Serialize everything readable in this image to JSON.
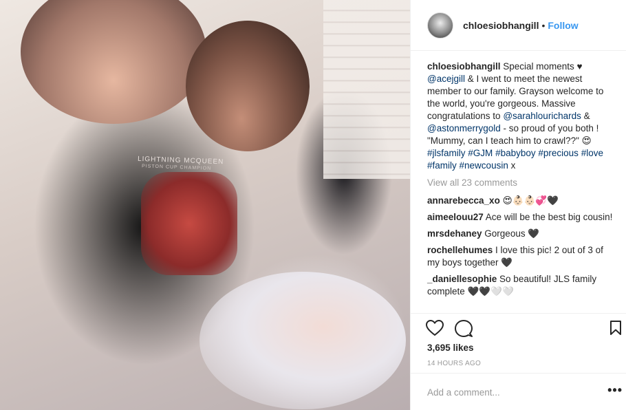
{
  "post": {
    "photo_alt": "Photo of a woman and a toddler with a newborn baby",
    "shirt_text": "LIGHTNING MCQUEEN",
    "shirt_subtext": "PISTON CUP CHAMPION"
  },
  "header": {
    "username": "chloesiobhangill",
    "separator": "•",
    "follow_label": "Follow"
  },
  "caption": {
    "username": "chloesiobhangill",
    "t1": " Special moments ♥ ",
    "m1": "@acejgill",
    "t2": " & I went to meet the newest member to our family. Grayson welcome to the world, you're gorgeous. Massive congratulations to ",
    "m2": "@sarahlourichards",
    "t3": " & ",
    "m3": "@astonmerrygold",
    "t4": " - so proud of you both ! \"Mummy, can I teach him to crawl??\" 😍 ",
    "h1": "#jlsfamily",
    "h2": "#GJM",
    "h3": "#babyboy",
    "h4": "#precious",
    "h5": "#love",
    "h6": "#family",
    "h7": "#newcousin",
    "t5": " x"
  },
  "view_all_comments": "View all 23 comments",
  "comments": [
    {
      "user": "annarebecca_xo",
      "text": " 😍👶🏻👶🏻💞🖤"
    },
    {
      "user": "aimeelouu27",
      "text": " Ace will be the best big cousin!"
    },
    {
      "user": "mrsdehaney",
      "text": " Gorgeous 🖤"
    },
    {
      "user": "rochellehumes",
      "text": " I love this pic! 2 out of 3 of my boys together 🖤"
    },
    {
      "user": "_daniellesophie",
      "text": " So beautiful! JLS family complete 🖤🖤🤍🤍"
    }
  ],
  "actions": {
    "icons": [
      "heart-icon",
      "comment-icon",
      "bookmark-icon"
    ]
  },
  "likes_text": "3,695 likes",
  "timestamp": "14 HOURS AGO",
  "add_comment": {
    "placeholder": "Add a comment...",
    "more_label": "•••"
  },
  "colors": {
    "link": "#003569",
    "follow": "#3897f0",
    "muted": "#999999",
    "text": "#262626",
    "border": "#efefef"
  }
}
